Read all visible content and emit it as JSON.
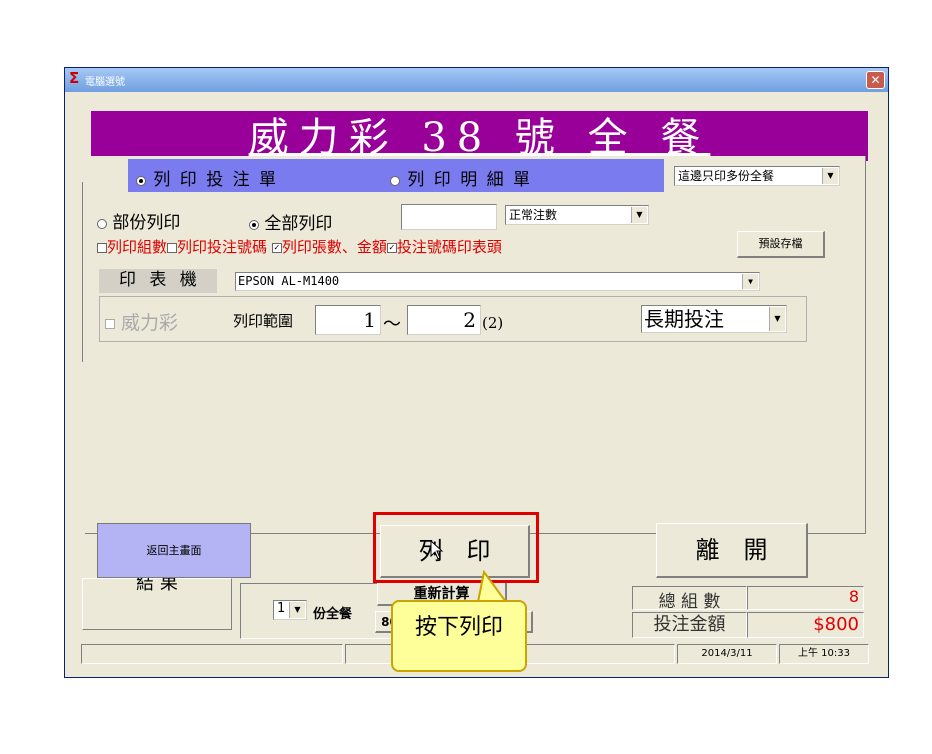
{
  "window": {
    "title": "電腦選號",
    "title_icon": "Σ",
    "close": "✕"
  },
  "banner": {
    "title": "威力彩 38 號 全 餐"
  },
  "dialog": {
    "print_bet_slip": "列 印 投 注 單",
    "print_detail": "列 印 明 細 單",
    "extra_copies_option": "這邊只印多份全餐",
    "partial_print": "部份列印",
    "full_print": "全部列印",
    "count_mode": "正常注數",
    "checks": {
      "print_group_count": "列印組數",
      "print_bet_number": "列印投注號碼",
      "print_sheets_amount": "列印張數、金額",
      "print_header": "投注號碼印表頭"
    },
    "preset_save": "預設存檔",
    "printer_label": "印 表 機",
    "printer_value": "EPSON AL-M1400",
    "lottery_label": "威力彩",
    "range_label": "列印範圍",
    "range_from": "1",
    "range_sep": "～",
    "range_to": "2",
    "range_count": "(2)",
    "period_value": "長期投注",
    "back_main": "返回主畫面",
    "print_button": "列　印",
    "exit_button": "離　開"
  },
  "main_form": {
    "result_tab": "結 果",
    "copies_value": "1",
    "copies_suffix": "份全餐",
    "recalc_button": "重新計算",
    "partial_value": "80",
    "total_groups_label": "總 組 數",
    "total_groups_value": "8",
    "bet_amount_label": "投注金額",
    "bet_amount_value": "$800",
    "status_date": "2014/3/11",
    "status_time": "上午 10:33"
  },
  "callout": {
    "text": "按下列印"
  },
  "colors": {
    "banner": "#990099",
    "highlight": "#e00000",
    "callout": "#ffff99",
    "red_text": "#e00000"
  }
}
